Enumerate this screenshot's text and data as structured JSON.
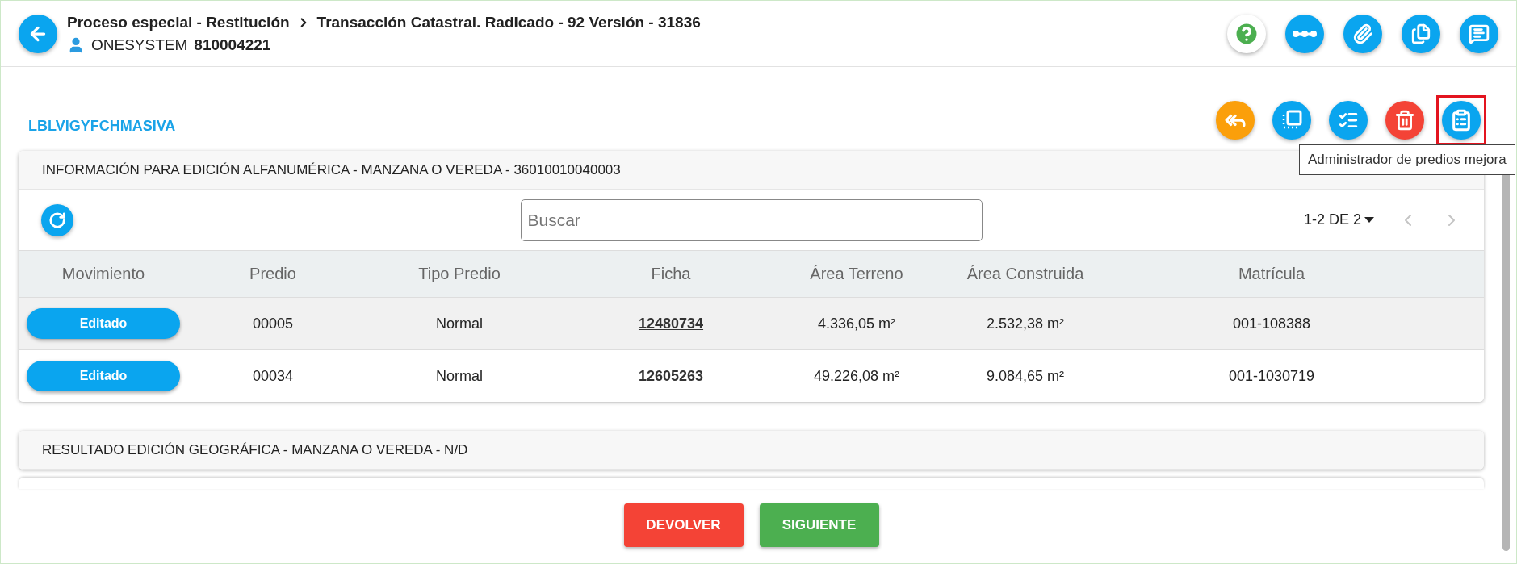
{
  "header": {
    "breadcrumb": [
      "Proceso especial - Restitución",
      "Transacción Catastral. Radicado - 92 Versión - 31836"
    ],
    "user_name": "ONESYSTEM",
    "user_id": "810004221"
  },
  "link": "LBLVIGYFCHMASIVA",
  "actions": [
    {
      "kind": "reply-all",
      "highlighted": false
    },
    {
      "kind": "select",
      "highlighted": false
    },
    {
      "kind": "list-check",
      "highlighted": false
    },
    {
      "kind": "delete",
      "highlighted": false
    },
    {
      "kind": "clipboard",
      "highlighted": true
    }
  ],
  "tooltip": "Administrador de predios mejora",
  "panel": {
    "title": "INFORMACIÓN PARA EDICIÓN ALFANUMÉRICA - MANZANA O VEREDA - 36010010040003",
    "search": {
      "placeholder": "Buscar"
    },
    "pagination": {
      "label": "1-2 DE 2",
      "previous_disabled": true,
      "next_disabled": true
    },
    "table": {
      "columns": [
        "Movimiento",
        "Predio",
        "Tipo Predio",
        "Ficha",
        "Área Terreno",
        "Área Construida",
        "Matrícula"
      ],
      "rows": [
        {
          "selected": true,
          "cells": [
            "Editado",
            "00005",
            "Normal",
            "12480734",
            "4.336,05 m²",
            "2.532,38 m²",
            "001-108388"
          ]
        },
        {
          "selected": false,
          "cells": [
            "Editado",
            "00034",
            "Normal",
            "12605263",
            "49.226,08 m²",
            "9.084,65 m²",
            "001-1030719"
          ]
        }
      ]
    }
  },
  "panel_2": {
    "title": "RESULTADO EDICIÓN GEOGRÁFICA - MANZANA O VEREDA - N/D"
  },
  "buttons": [
    {
      "label": "DEVOLVER",
      "kind": "danger"
    },
    {
      "label": "SIGUIENTE",
      "kind": "success"
    }
  ]
}
